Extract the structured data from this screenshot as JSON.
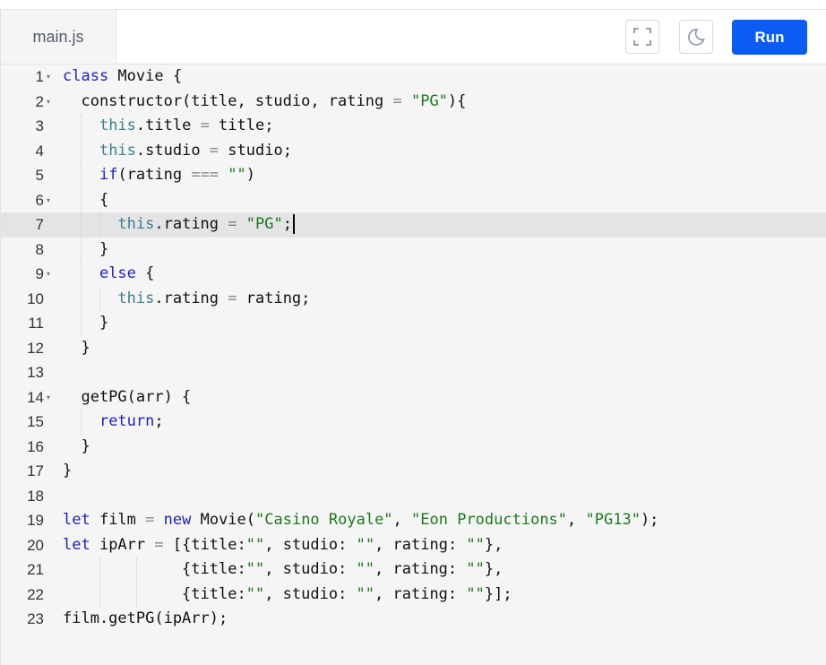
{
  "tab": {
    "filename": "main.js"
  },
  "toolbar": {
    "fullscreen_icon": "fullscreen-icon",
    "theme_icon": "moon-icon",
    "run_label": "Run",
    "run_color": "#0a5cf5"
  },
  "editor": {
    "active_line": 7,
    "lines": [
      {
        "n": "1",
        "fold": true,
        "code": "class Movie {"
      },
      {
        "n": "2",
        "fold": true,
        "code": "  constructor(title, studio, rating = \"PG\"){"
      },
      {
        "n": "3",
        "fold": false,
        "code": "    this.title = title;"
      },
      {
        "n": "4",
        "fold": false,
        "code": "    this.studio = studio;"
      },
      {
        "n": "5",
        "fold": false,
        "code": "    if(rating === \"\")"
      },
      {
        "n": "6",
        "fold": true,
        "code": "    {"
      },
      {
        "n": "7",
        "fold": false,
        "code": "      this.rating = \"PG\";"
      },
      {
        "n": "8",
        "fold": false,
        "code": "    }"
      },
      {
        "n": "9",
        "fold": true,
        "code": "    else {"
      },
      {
        "n": "10",
        "fold": false,
        "code": "      this.rating = rating;"
      },
      {
        "n": "11",
        "fold": false,
        "code": "    }"
      },
      {
        "n": "12",
        "fold": false,
        "code": "  }"
      },
      {
        "n": "13",
        "fold": false,
        "code": ""
      },
      {
        "n": "14",
        "fold": true,
        "code": "  getPG(arr) {"
      },
      {
        "n": "15",
        "fold": false,
        "code": "    return;"
      },
      {
        "n": "16",
        "fold": false,
        "code": "  }"
      },
      {
        "n": "17",
        "fold": false,
        "code": "}"
      },
      {
        "n": "18",
        "fold": false,
        "code": ""
      },
      {
        "n": "19",
        "fold": false,
        "code": "let film = new Movie(\"Casino Royale\", \"Eon Productions\", \"PG13\");"
      },
      {
        "n": "20",
        "fold": false,
        "code": "let ipArr = [{title:\"\", studio: \"\", rating: \"\"},"
      },
      {
        "n": "21",
        "fold": false,
        "code": "             {title:\"\", studio: \"\", rating: \"\"},"
      },
      {
        "n": "22",
        "fold": false,
        "code": "             {title:\"\", studio: \"\", rating: \"\"}];"
      },
      {
        "n": "23",
        "fold": false,
        "code": "film.getPG(ipArr);"
      }
    ]
  }
}
